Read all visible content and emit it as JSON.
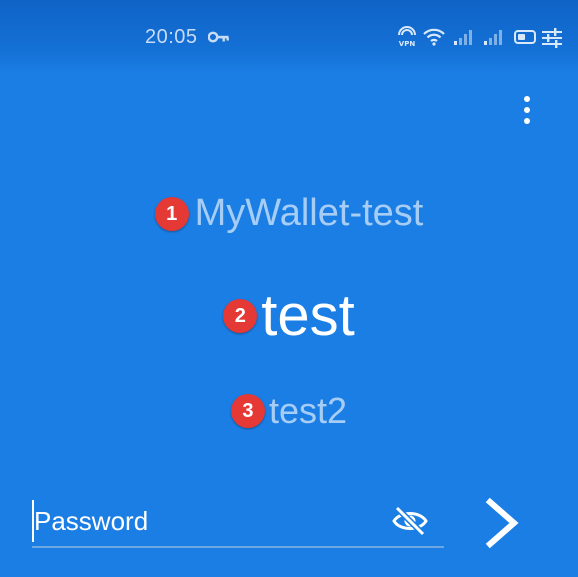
{
  "status_bar": {
    "time": "20:05",
    "icons": [
      "key-icon",
      "vpn-icon",
      "wifi-icon",
      "signal-icon",
      "signal-icon",
      "battery-icon",
      "tune-icon"
    ]
  },
  "menu": {
    "icon": "more-vert-icon"
  },
  "wallets": [
    {
      "marker": "1",
      "name": "MyWallet-test"
    },
    {
      "marker": "2",
      "name": "test"
    },
    {
      "marker": "3",
      "name": "test2"
    }
  ],
  "password": {
    "placeholder": "Password",
    "value": ""
  },
  "colors": {
    "background": "#1b7ee5",
    "status_bar": "#0f63c6",
    "inactive_text": "#a6cdf5",
    "active_text": "#ffffff",
    "marker": "#e53935"
  }
}
